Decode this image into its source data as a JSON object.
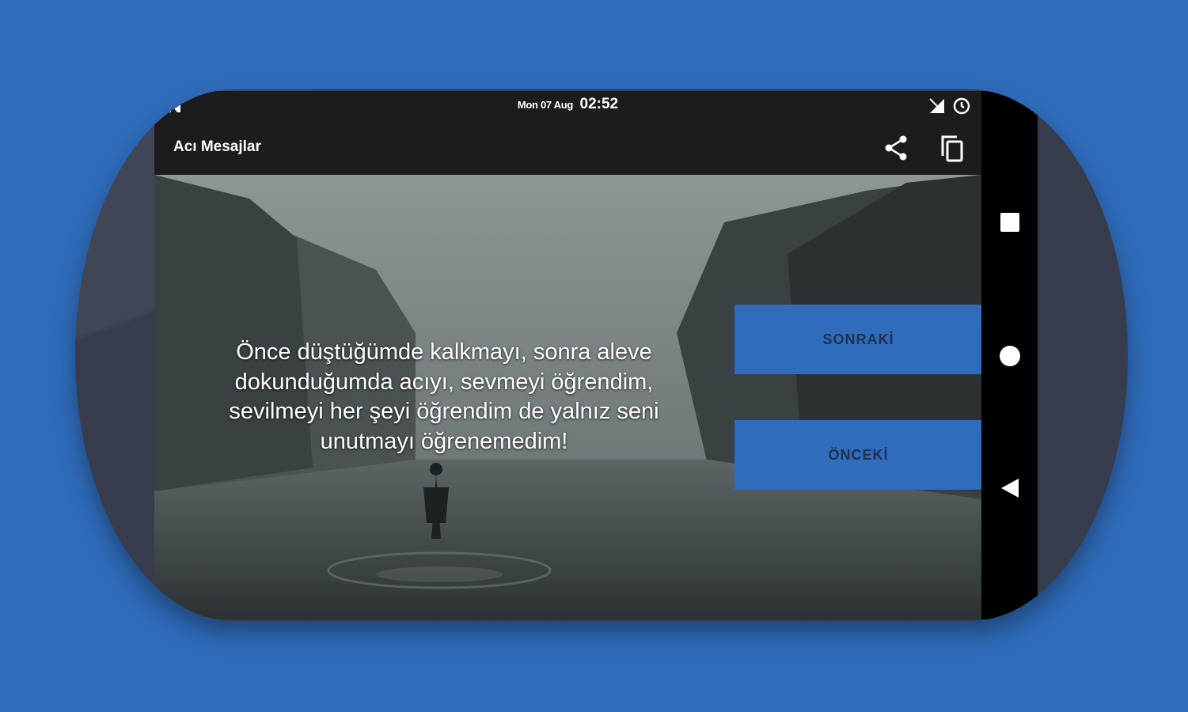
{
  "status_bar": {
    "date": "Mon 07 Aug",
    "time": "02:52",
    "left_icon": "n-notification-icon",
    "signal_icon": "signal-icon",
    "sync_icon": "sync-icon"
  },
  "app_bar": {
    "title": "Acı Mesajlar",
    "actions": [
      "share-icon",
      "copy-icon"
    ]
  },
  "content": {
    "quote": "Önce düştüğümde kalkmayı, sonra aleve dokunduğumda acıyı, sevmeyi öğrendim, sevilmeyi her şeyi öğrendim de yalnız seni unutmayı öğrenemedim!",
    "next_label": "SONRAKİ",
    "prev_label": "ÖNCEKİ"
  },
  "nav_bar": {
    "icons": [
      "recents-icon",
      "home-icon",
      "back-icon"
    ]
  },
  "colors": {
    "background": "#2f6cbb",
    "phone_body": "#363c4c",
    "app_bar": "#1c1c1c",
    "button": "#2f6cbb",
    "button_text": "#1f3250"
  }
}
